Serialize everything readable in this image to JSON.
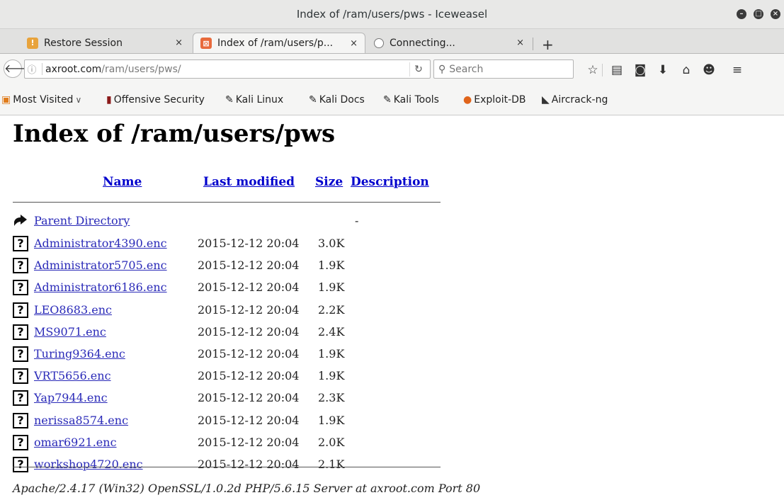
{
  "window": {
    "title": "Index of /ram/users/pws - Iceweasel"
  },
  "tabs": [
    {
      "label": "Restore Session",
      "close": "×",
      "icon": "restore-icon"
    },
    {
      "label": "Index of /ram/users/p...",
      "close": "×",
      "icon": "page-icon",
      "active": true
    },
    {
      "label": "Connecting...",
      "close": "×",
      "icon": "loading-icon"
    }
  ],
  "newtab": "+",
  "nav": {
    "url_host": "axroot.com",
    "url_path": "/ram/users/pws/",
    "search_placeholder": "Search"
  },
  "bookmarks": [
    {
      "label": "Most Visited",
      "suffix": "∨",
      "icon": "most-visited-icon"
    },
    {
      "label": "Offensive Security",
      "icon": "offsec-icon"
    },
    {
      "label": "Kali Linux",
      "icon": "kali-icon"
    },
    {
      "label": "Kali Docs",
      "icon": "kali-icon"
    },
    {
      "label": "Kali Tools",
      "icon": "kali-icon"
    },
    {
      "label": "Exploit-DB",
      "icon": "exploitdb-icon"
    },
    {
      "label": "Aircrack-ng",
      "icon": "aircrack-icon"
    }
  ],
  "page": {
    "title": "Index of /ram/users/pws",
    "headers": {
      "name": "Name",
      "modified": "Last modified",
      "size": "Size",
      "description": "Description"
    },
    "parent": {
      "name": "Parent Directory",
      "size": "-"
    },
    "files": [
      {
        "name": "Administrator4390.enc",
        "date": "2015-12-12 20:04",
        "size": "3.0K"
      },
      {
        "name": "Administrator5705.enc",
        "date": "2015-12-12 20:04",
        "size": "1.9K"
      },
      {
        "name": "Administrator6186.enc",
        "date": "2015-12-12 20:04",
        "size": "1.9K"
      },
      {
        "name": "LEO8683.enc",
        "date": "2015-12-12 20:04",
        "size": "2.2K"
      },
      {
        "name": "MS9071.enc",
        "date": "2015-12-12 20:04",
        "size": "2.4K"
      },
      {
        "name": "Turing9364.enc",
        "date": "2015-12-12 20:04",
        "size": "1.9K"
      },
      {
        "name": "VRT5656.enc",
        "date": "2015-12-12 20:04",
        "size": "1.9K"
      },
      {
        "name": "Yap7944.enc",
        "date": "2015-12-12 20:04",
        "size": "2.3K"
      },
      {
        "name": "nerissa8574.enc",
        "date": "2015-12-12 20:04",
        "size": "1.9K"
      },
      {
        "name": "omar6921.enc",
        "date": "2015-12-12 20:04",
        "size": "2.0K"
      },
      {
        "name": "workshop4720.enc",
        "date": "2015-12-12 20:04",
        "size": "2.1K"
      }
    ],
    "footer": "Apache/2.4.17 (Win32) OpenSSL/1.0.2d PHP/5.6.15 Server at axroot.com Port 80"
  }
}
